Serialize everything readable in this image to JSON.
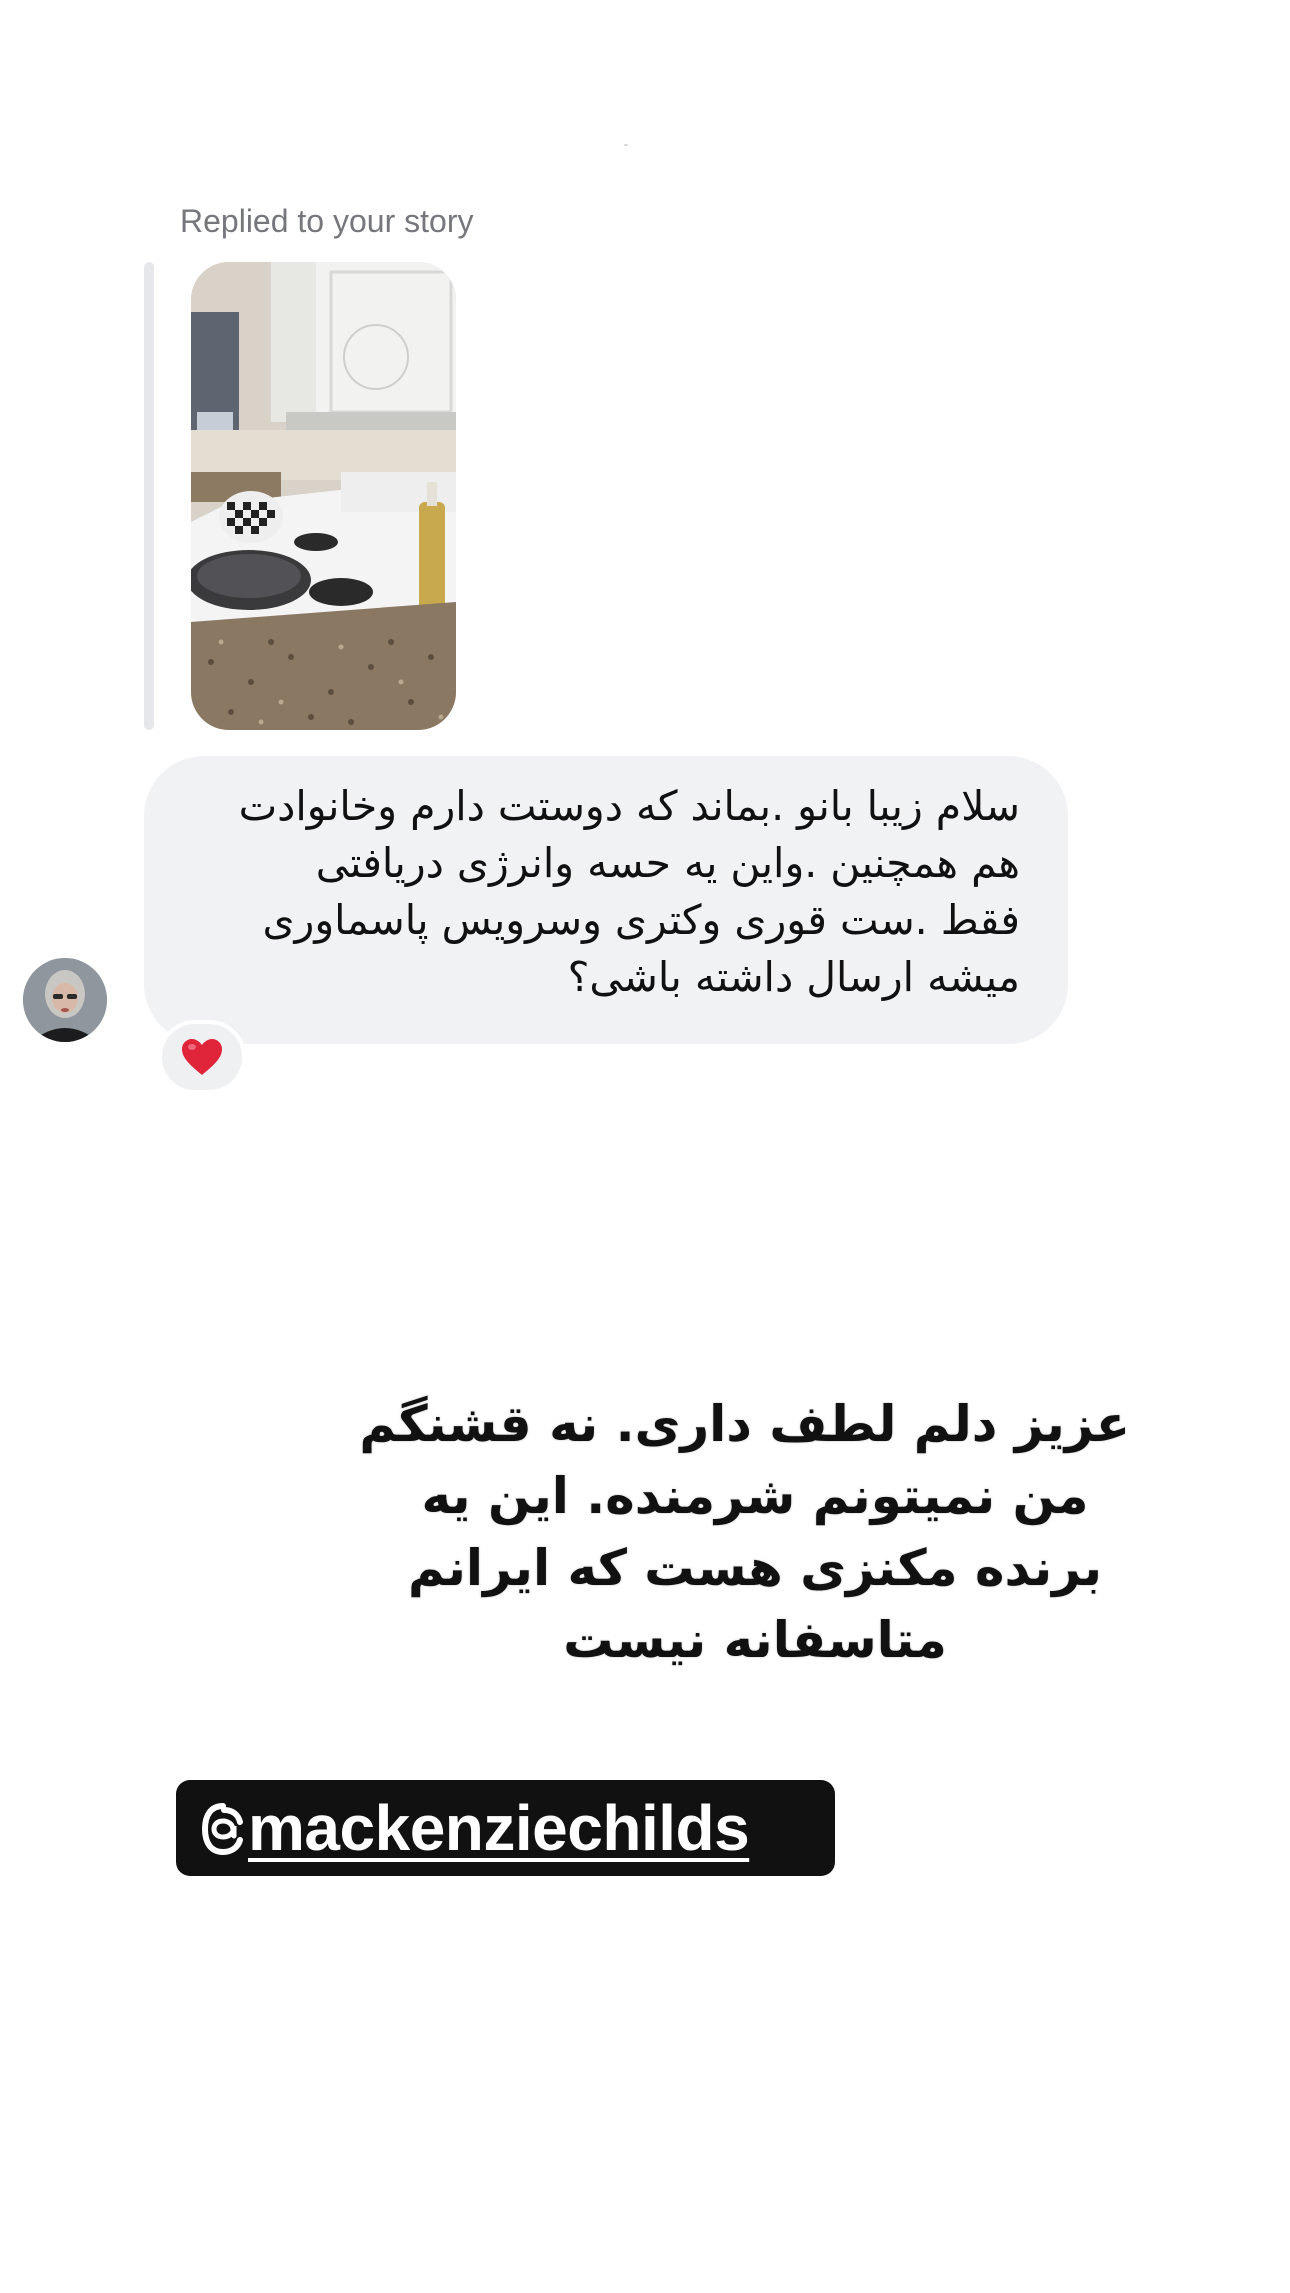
{
  "reply_header": {
    "label": "Replied to your story"
  },
  "message": {
    "lines": [
      "سلام زیبا بانو .بماند که دوستت دارم وخانوادت",
      "هم همچنین .واین یه حسه وانرژی دریافتی",
      "فقط .ست قوری وکتری وسرویس پاسماوری",
      "میشه ارسال داشته باشی؟"
    ],
    "reaction_emoji": "❤️"
  },
  "caption": {
    "lines": [
      "عزیز دلم لطف داری. نه قشنگم",
      "من نمیتونم شرمنده. این یه",
      "برنده مکنزی هست که ایرانم",
      "متاسفانه نیست"
    ]
  },
  "mention": {
    "handle": "mackenzie childs",
    "display": "mackenziechilds",
    "icon": "threads-icon"
  },
  "colors": {
    "bubble": "#f1f2f4",
    "label_gray": "#76777c",
    "mention_bg": "#111111"
  }
}
